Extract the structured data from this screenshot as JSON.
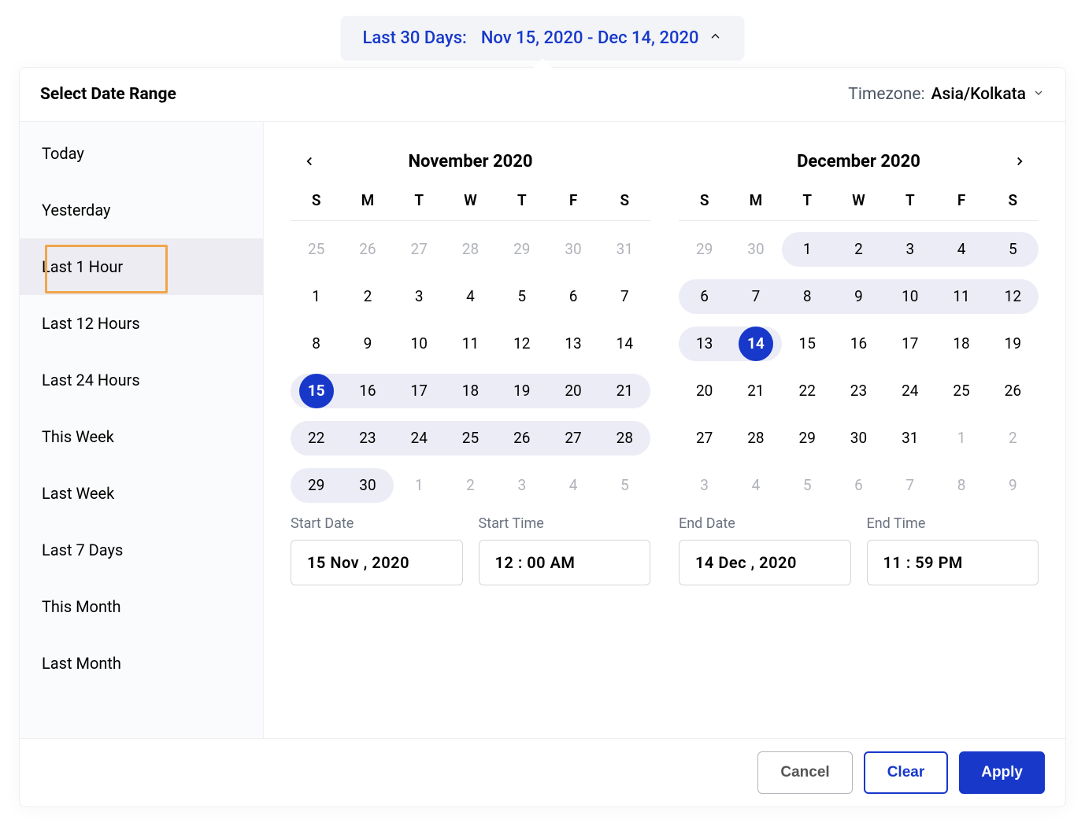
{
  "trigger": {
    "label": "Last 30 Days:",
    "range": "Nov 15, 2020 - Dec 14, 2020"
  },
  "header": {
    "title": "Select Date Range",
    "timezone_label": "Timezone:",
    "timezone_value": "Asia/Kolkata"
  },
  "sidebar": {
    "items": [
      "Today",
      "Yesterday",
      "Last 1 Hour",
      "Last 12 Hours",
      "Last 24 Hours",
      "This Week",
      "Last Week",
      "Last 7 Days",
      "This Month",
      "Last Month"
    ]
  },
  "dow": [
    "S",
    "M",
    "T",
    "W",
    "T",
    "F",
    "S"
  ],
  "calendars": [
    {
      "title": "November 2020",
      "weeks": [
        [
          {
            "d": 25,
            "o": true
          },
          {
            "d": 26,
            "o": true
          },
          {
            "d": 27,
            "o": true
          },
          {
            "d": 28,
            "o": true
          },
          {
            "d": 29,
            "o": true
          },
          {
            "d": 30,
            "o": true
          },
          {
            "d": 31,
            "o": true
          }
        ],
        [
          {
            "d": 1
          },
          {
            "d": 2
          },
          {
            "d": 3
          },
          {
            "d": 4
          },
          {
            "d": 5
          },
          {
            "d": 6
          },
          {
            "d": 7
          }
        ],
        [
          {
            "d": 8
          },
          {
            "d": 9
          },
          {
            "d": 10
          },
          {
            "d": 11
          },
          {
            "d": 12
          },
          {
            "d": 13
          },
          {
            "d": 14
          }
        ],
        [
          {
            "d": 15,
            "r": true,
            "ep": true
          },
          {
            "d": 16,
            "r": true
          },
          {
            "d": 17,
            "r": true
          },
          {
            "d": 18,
            "r": true
          },
          {
            "d": 19,
            "r": true
          },
          {
            "d": 20,
            "r": true
          },
          {
            "d": 21,
            "r": true
          }
        ],
        [
          {
            "d": 22,
            "r": true
          },
          {
            "d": 23,
            "r": true
          },
          {
            "d": 24,
            "r": true
          },
          {
            "d": 25,
            "r": true
          },
          {
            "d": 26,
            "r": true
          },
          {
            "d": 27,
            "r": true
          },
          {
            "d": 28,
            "r": true
          }
        ],
        [
          {
            "d": 29,
            "r": true
          },
          {
            "d": 30,
            "r": true
          },
          {
            "d": 1,
            "o": true
          },
          {
            "d": 2,
            "o": true
          },
          {
            "d": 3,
            "o": true
          },
          {
            "d": 4,
            "o": true
          },
          {
            "d": 5,
            "o": true
          }
        ]
      ],
      "start_date_label": "Start Date",
      "start_time_label": "Start Time",
      "start_date_value": "15 Nov , 2020",
      "start_time_value": "12 : 00 AM"
    },
    {
      "title": "December 2020",
      "weeks": [
        [
          {
            "d": 29,
            "o": true
          },
          {
            "d": 30,
            "o": true
          },
          {
            "d": 1,
            "r": true
          },
          {
            "d": 2,
            "r": true
          },
          {
            "d": 3,
            "r": true
          },
          {
            "d": 4,
            "r": true
          },
          {
            "d": 5,
            "r": true
          }
        ],
        [
          {
            "d": 6,
            "r": true
          },
          {
            "d": 7,
            "r": true
          },
          {
            "d": 8,
            "r": true
          },
          {
            "d": 9,
            "r": true
          },
          {
            "d": 10,
            "r": true
          },
          {
            "d": 11,
            "r": true
          },
          {
            "d": 12,
            "r": true
          }
        ],
        [
          {
            "d": 13,
            "r": true
          },
          {
            "d": 14,
            "r": true,
            "ep": true
          },
          {
            "d": 15
          },
          {
            "d": 16
          },
          {
            "d": 17
          },
          {
            "d": 18
          },
          {
            "d": 19
          }
        ],
        [
          {
            "d": 20
          },
          {
            "d": 21
          },
          {
            "d": 22
          },
          {
            "d": 23
          },
          {
            "d": 24
          },
          {
            "d": 25
          },
          {
            "d": 26
          }
        ],
        [
          {
            "d": 27
          },
          {
            "d": 28
          },
          {
            "d": 29
          },
          {
            "d": 30
          },
          {
            "d": 31
          },
          {
            "d": 1,
            "o": true
          },
          {
            "d": 2,
            "o": true
          }
        ],
        [
          {
            "d": 3,
            "o": true
          },
          {
            "d": 4,
            "o": true
          },
          {
            "d": 5,
            "o": true
          },
          {
            "d": 6,
            "o": true
          },
          {
            "d": 7,
            "o": true
          },
          {
            "d": 8,
            "o": true
          },
          {
            "d": 9,
            "o": true
          }
        ]
      ],
      "end_date_label": "End Date",
      "end_time_label": "End Time",
      "end_date_value": "14 Dec , 2020",
      "end_time_value": "11 : 59 PM"
    }
  ],
  "footer": {
    "cancel": "Cancel",
    "clear": "Clear",
    "apply": "Apply"
  }
}
